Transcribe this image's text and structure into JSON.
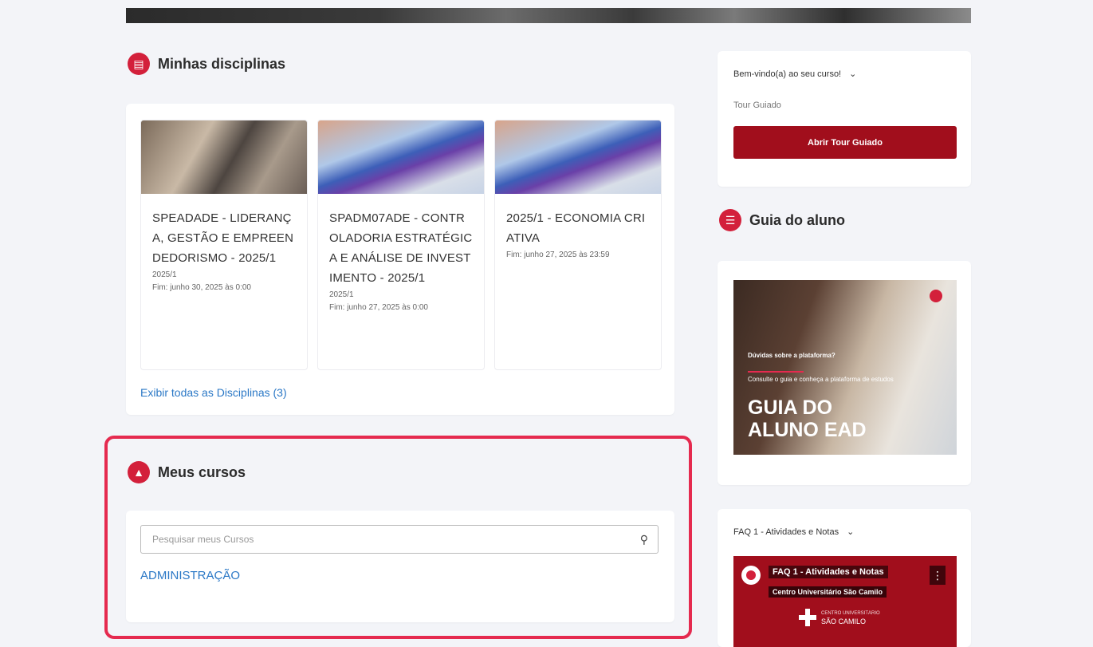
{
  "disciplinas": {
    "title": "Minhas disciplinas",
    "icon": "book-icon",
    "courses": [
      {
        "title": "SPEADADE - LIDERANÇA, GESTÃO E EMPREENDEDORISMO - 2025/1",
        "term": "2025/1",
        "end": "Fim: junho 30, 2025 às 0:00"
      },
      {
        "title": "SPADM07ADE - CONTROLADORIA ESTRATÉGICA E ANÁLISE DE INVESTIMENTO - 2025/1",
        "term": "2025/1",
        "end": "Fim: junho 27, 2025 às 0:00"
      },
      {
        "title": "2025/1 - ECONOMIA CRIATIVA",
        "term": "",
        "end": "Fim: junho 27, 2025 às 23:59"
      }
    ],
    "show_all": "Exibir todas as Disciplinas (3)"
  },
  "cursos": {
    "title": "Meus cursos",
    "icon": "graduation-icon",
    "search_placeholder": "Pesquisar meus Cursos",
    "items": [
      "ADMINISTRAÇÃO"
    ]
  },
  "welcome": {
    "heading": "Bem-vindo(a) ao seu curso!",
    "subtitle": "Tour Guiado",
    "button": "Abrir Tour Guiado"
  },
  "guia": {
    "title": "Guia do aluno",
    "icon": "list-icon",
    "image_small": "Dúvidas sobre a plataforma?",
    "image_caption": "Consulte o guia e conheça a plataforma de estudos",
    "image_big": "GUIA DO ALUNO EAD"
  },
  "faq": {
    "heading": "FAQ 1 - Atividades e Notas",
    "video_title": "FAQ 1 - Atividades e Notas",
    "channel": "Centro Universitário São Camilo",
    "brand_top": "CENTRO UNIVERSITÁRIO",
    "brand": "SÃO CAMILO"
  },
  "colors": {
    "accent": "#d3203b",
    "button": "#a10e1c",
    "highlight": "#e52a4f",
    "link": "#2b78c6"
  }
}
